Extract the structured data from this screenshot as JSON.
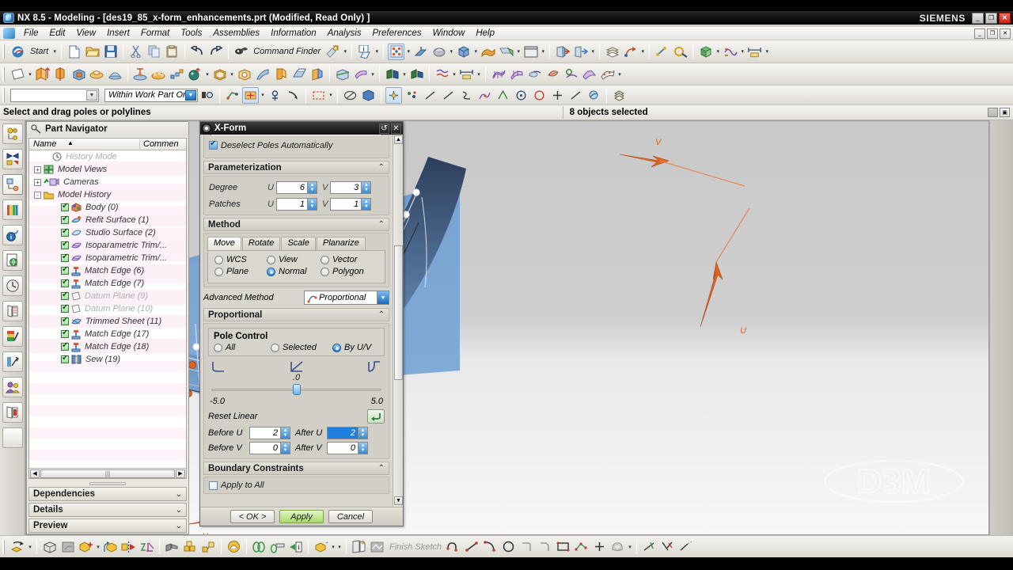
{
  "window": {
    "title": "NX 8.5 - Modeling - [des19_85_x-form_enhancements.prt (Modified, Read Only) ]",
    "brand": "SIEMENS",
    "buttons": {
      "minimize": "_",
      "restore": "❐",
      "close": "✕"
    },
    "mdi_buttons": {
      "minimize": "_",
      "restore": "❐",
      "close": "✕"
    }
  },
  "menu": {
    "items": [
      {
        "label": "File"
      },
      {
        "label": "Edit"
      },
      {
        "label": "View"
      },
      {
        "label": "Insert"
      },
      {
        "label": "Format"
      },
      {
        "label": "Tools"
      },
      {
        "label": "Assemblies"
      },
      {
        "label": "Information"
      },
      {
        "label": "Analysis"
      },
      {
        "label": "Preferences"
      },
      {
        "label": "Window"
      },
      {
        "label": "Help"
      }
    ]
  },
  "toolbar_standard": {
    "start_label": "Start",
    "command_finder_label": "Command Finder",
    "icons": [
      "start-menu-icon",
      "new-file-icon",
      "open-file-icon",
      "save-icon",
      "cut-icon",
      "copy-icon",
      "paste-icon",
      "undo-icon",
      "redo-icon",
      "command-finder-icon",
      "customize-icon",
      "info-icon",
      "help-object-icon",
      "point-set-icon",
      "wcs-icon",
      "render-style-icon",
      "solid-body-icon",
      "sheet-body-icon",
      "shaded-face-icon",
      "window-icon",
      "enter-part-icon",
      "leave-part-icon",
      "layer-settings-icon",
      "move-object-icon",
      "measure-distance-icon",
      "analysis-icon"
    ]
  },
  "toolbar_feature": {
    "icons": [
      "datum-plane-icon",
      "extrude-icon",
      "revolve-icon",
      "block-icon",
      "boss-icon",
      "dome-icon",
      "hole-icon",
      "emboss-icon",
      "pattern-feature-icon",
      "sphere-icon",
      "shell-icon",
      "tube-icon",
      "taper-icon",
      "edge-blend-icon",
      "chamfer-icon",
      "draft-icon",
      "trim-body-icon",
      "offset-face-icon",
      "sew-icon",
      "thicken-icon",
      "studio-surface-icon",
      "through-curves-icon",
      "swept-icon",
      "n-sided-surface-icon",
      "bridge-surface-icon",
      "law-extension-icon",
      "x-form-icon"
    ]
  },
  "toolbar_selection": {
    "filter_placeholder": "",
    "scope_value": "Within Work Part Only",
    "icons": [
      "selection-filter-combo",
      "scope-combo",
      "snap-point-icon",
      "face-select-icon",
      "curve-select-icon",
      "feature-select-icon",
      "component-select-icon",
      "rectangle-select-icon",
      "deselect-icon",
      "shaded-select-icon",
      "point-snap-icon",
      "existing-point-icon",
      "endpoint-icon",
      "midpoint-icon",
      "control-point-icon",
      "intersection-icon",
      "arc-center-icon",
      "quadrant-point-icon",
      "point-on-curve-icon",
      "point-on-face-icon",
      "snap-settings-icon"
    ]
  },
  "status": {
    "cue": "Select and drag poles or polylines",
    "selection": "8 objects selected"
  },
  "resource_bar": {
    "items": [
      {
        "name": "assembly-navigator-icon",
        "active": false
      },
      {
        "name": "constraint-navigator-icon",
        "active": false
      },
      {
        "name": "part-navigator-icon",
        "active": true
      },
      {
        "name": "reuse-library-icon",
        "active": false
      },
      {
        "name": "hd3d-tools-icon",
        "active": false
      },
      {
        "name": "web-browser-icon",
        "active": false
      },
      {
        "name": "history-icon",
        "active": false
      },
      {
        "name": "system-materials-icon",
        "active": false
      },
      {
        "name": "system-scenes-icon",
        "active": false
      },
      {
        "name": "system-visual-icon",
        "active": false
      },
      {
        "name": "roles-icon",
        "active": false
      },
      {
        "name": "process-studio-icon",
        "active": false
      },
      {
        "name": "blank-tab-icon",
        "active": false
      }
    ]
  },
  "part_navigator": {
    "title": "Part Navigator",
    "columns": [
      "Name",
      "Commen"
    ],
    "sort_indicator": "▲",
    "tree": [
      {
        "label": "History Mode",
        "icon": "clock-icon",
        "indent": 1,
        "expander": "",
        "check": false,
        "dim": true
      },
      {
        "label": "Model Views",
        "icon": "model-views-icon",
        "indent": 0,
        "expander": "+",
        "check": false,
        "dim": false
      },
      {
        "label": "Cameras",
        "icon": "cameras-icon",
        "indent": 0,
        "expander": "+",
        "check": false,
        "dim": false
      },
      {
        "label": "Model History",
        "icon": "folder-icon",
        "indent": 0,
        "expander": "-",
        "check": false,
        "dim": false
      },
      {
        "label": "Body (0)",
        "icon": "body-icon",
        "indent": 2,
        "expander": "",
        "check": true,
        "dim": false
      },
      {
        "label": "Refit Surface (1)",
        "icon": "refit-surface-icon",
        "indent": 2,
        "expander": "",
        "check": true,
        "dim": false
      },
      {
        "label": "Studio Surface (2)",
        "icon": "studio-surface-icon",
        "indent": 2,
        "expander": "",
        "check": true,
        "dim": false
      },
      {
        "label": "Isoparametric Trim/...",
        "icon": "iso-trim-icon",
        "indent": 2,
        "expander": "",
        "check": true,
        "dim": false
      },
      {
        "label": "Isoparametric Trim/...",
        "icon": "iso-trim-icon",
        "indent": 2,
        "expander": "",
        "check": true,
        "dim": false
      },
      {
        "label": "Match Edge (6)",
        "icon": "match-edge-icon",
        "indent": 2,
        "expander": "",
        "check": true,
        "dim": false
      },
      {
        "label": "Match Edge (7)",
        "icon": "match-edge-icon",
        "indent": 2,
        "expander": "",
        "check": true,
        "dim": false
      },
      {
        "label": "Datum Plane (9)",
        "icon": "datum-plane-icon",
        "indent": 2,
        "expander": "",
        "check": true,
        "dim": true
      },
      {
        "label": "Datum Plane (10)",
        "icon": "datum-plane-icon",
        "indent": 2,
        "expander": "",
        "check": true,
        "dim": true
      },
      {
        "label": "Trimmed Sheet (11)",
        "icon": "trimmed-sheet-icon",
        "indent": 2,
        "expander": "",
        "check": true,
        "dim": false
      },
      {
        "label": "Match Edge (17)",
        "icon": "match-edge-icon",
        "indent": 2,
        "expander": "",
        "check": true,
        "dim": false
      },
      {
        "label": "Match Edge (18)",
        "icon": "match-edge-icon",
        "indent": 2,
        "expander": "",
        "check": true,
        "dim": false
      },
      {
        "label": "Sew (19)",
        "icon": "sew-icon",
        "indent": 2,
        "expander": "",
        "check": true,
        "dim": false
      }
    ],
    "panels": [
      {
        "label": "Dependencies",
        "chevron": "⌄"
      },
      {
        "label": "Details",
        "chevron": "⌄"
      },
      {
        "label": "Preview",
        "chevron": "⌄"
      }
    ]
  },
  "dialog": {
    "title": "X-Form",
    "title_buttons": {
      "reset": "↺",
      "close": "✕"
    },
    "deselect_poles": {
      "label": "Deselect Poles Automatically",
      "checked": true
    },
    "parameterization": {
      "header": "Parameterization",
      "chevron": "⌃",
      "rows": [
        {
          "label": "Degree",
          "u_label": "U",
          "u_value": "6",
          "v_label": "V",
          "v_value": "3"
        },
        {
          "label": "Patches",
          "u_label": "U",
          "u_value": "1",
          "v_label": "V",
          "v_value": "1"
        }
      ]
    },
    "method": {
      "header": "Method",
      "chevron": "⌃",
      "tabs": [
        {
          "label": "Move",
          "active": true
        },
        {
          "label": "Rotate",
          "active": false
        },
        {
          "label": "Scale",
          "active": false
        },
        {
          "label": "Planarize",
          "active": false
        }
      ],
      "radios": [
        {
          "label": "WCS",
          "selected": false
        },
        {
          "label": "View",
          "selected": false
        },
        {
          "label": "Vector",
          "selected": false
        },
        {
          "label": "Plane",
          "selected": false
        },
        {
          "label": "Normal",
          "selected": true
        },
        {
          "label": "Polygon",
          "selected": false
        }
      ]
    },
    "advanced_method": {
      "label": "Advanced Method",
      "value": "Proportional",
      "arrow": "▼"
    },
    "proportional": {
      "header": "Proportional",
      "chevron": "⌃",
      "pole_control": {
        "title": "Pole Control",
        "options": [
          {
            "label": "All",
            "selected": false
          },
          {
            "label": "Selected",
            "selected": false
          },
          {
            "label": "By U/V",
            "selected": true
          }
        ]
      },
      "curve_icons": [
        "curve-ease-in-icon",
        "curve-linear-icon",
        "curve-ease-out-icon"
      ],
      "slider": {
        "value": ".0",
        "min": "-5.0",
        "max": "5.0",
        "position_pct": 50
      },
      "reset_linear": {
        "label": "Reset Linear",
        "icon": "reset-arrow-icon"
      },
      "before_after": [
        {
          "before_label": "Before U",
          "before_value": "2",
          "after_label": "After U",
          "after_value": "2",
          "after_highlighted": true
        },
        {
          "before_label": "Before V",
          "before_value": "0",
          "after_label": "After V",
          "after_value": "0",
          "after_highlighted": false
        }
      ]
    },
    "boundary_constraints": {
      "header": "Boundary Constraints",
      "chevron": "⌃",
      "apply_to_all": "Apply to All"
    },
    "footer": [
      {
        "label": "< OK >",
        "kind": "ok"
      },
      {
        "label": "Apply",
        "kind": "apply"
      },
      {
        "label": "Cancel",
        "kind": "cancel"
      }
    ]
  },
  "viewport": {
    "axis_labels": {
      "u": "U",
      "v": "V"
    },
    "watermark": "D3M",
    "surface": {
      "type": "nurbs-sheet",
      "fill_top": "#3e5372",
      "fill_bottom": "#6f9ed0",
      "pole_color_default": "#ffffff",
      "pole_color_selected": "#e06a28"
    }
  },
  "bottom_toolbar": {
    "finish_sketch_label": "Finish Sketch",
    "icons": [
      "move-object-icon",
      "assembly-icon",
      "pattern-face-icon",
      "add-component-icon",
      "move-component-icon",
      "mirror-assembly-icon",
      "assembly-constraint-icon",
      "wave-geometry-icon",
      "arrange-icon",
      "sequence-icon",
      "clearance-icon",
      "weld-icon",
      "measure-icon",
      "information-icon",
      "explode-icon",
      "create-sketch-icon",
      "finish-sketch-icon",
      "profile-icon",
      "line-icon",
      "arc-icon",
      "circle-icon",
      "fillet-icon",
      "chamfer-icon",
      "rectangle-icon",
      "studio-spline-icon",
      "point-icon",
      "offset-curve-icon",
      "trim-icon",
      "quick-trim-icon",
      "extend-icon"
    ]
  }
}
